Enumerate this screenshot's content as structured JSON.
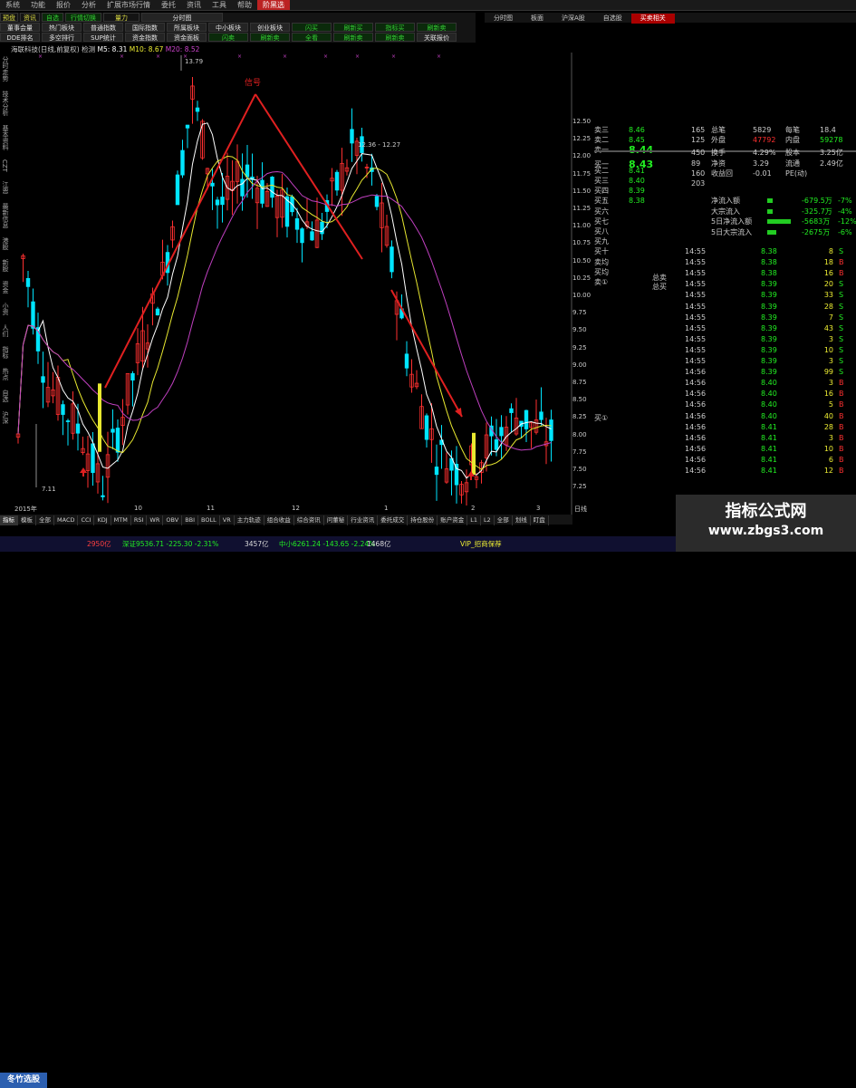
{
  "menu": [
    "系统",
    "功能",
    "报价",
    "分析",
    "扩展市场行情",
    "委托",
    "资讯",
    "工具",
    "帮助",
    "阶黑选"
  ],
  "menu_active_index": 9,
  "toolbar_row1": [
    "预盘",
    "资讯",
    "自选",
    "行情切换",
    "量力",
    "分时图"
  ],
  "toolbar_row2": [
    "董事会量",
    "热门板块",
    "普通指数",
    "国际指数",
    "所属板块",
    "中小板块",
    "创业板块",
    "闪买",
    "刷新买",
    "指标买",
    "刷新卖"
  ],
  "toolbar_row3": [
    "DDE排名",
    "多空排行",
    "SUP统计",
    "资金指数",
    "资金面板",
    "闪卖",
    "刷新卖",
    "全看",
    "刷新卖",
    "刷新卖",
    "关联报价"
  ],
  "right_toolbar": [
    "分时图",
    "板面",
    "沪深A股",
    "自选股",
    "买卖相关"
  ],
  "chart_title": {
    "name": "海联科技(日线,前复权) 检测",
    "m5": "M5: 8.31",
    "m10": "M10: 8.67",
    "m20": "M20: 8.52"
  },
  "left_strip": [
    "分时走势",
    "技术分析",
    "基本资料",
    "CZT",
    "江恩",
    "最新信息",
    "港股",
    "新股",
    "资金",
    "小资",
    "人们",
    "指标",
    "热点",
    "自选",
    "沪深"
  ],
  "annotations": {
    "peak": "13.79",
    "signal": "信号",
    "range": "12.36 - 12.27",
    "low": "7.11"
  },
  "y_axis": [
    "12.50",
    "12.25",
    "12.00",
    "11.75",
    "11.50",
    "11.25",
    "11.00",
    "10.75",
    "10.50",
    "10.25",
    "10.00",
    "9.75",
    "9.50",
    "9.25",
    "9.00",
    "8.75",
    "8.50",
    "8.25",
    "8.00",
    "7.75",
    "7.50",
    "7.25"
  ],
  "x_axis": [
    "2015年",
    "10",
    "11",
    "12",
    "1",
    "2",
    "3"
  ],
  "x_axis_right": "日线",
  "orderbook": [
    {
      "label": "卖三",
      "price": "8.46",
      "big": false
    },
    {
      "label": "卖二",
      "price": "8.45",
      "big": false
    },
    {
      "label": "卖一",
      "price": "8.44",
      "big": true
    },
    {
      "label": "买一",
      "price": "8.43",
      "big": true
    },
    {
      "label": "买二",
      "price": "8.41",
      "big": false
    },
    {
      "label": "买三",
      "price": "8.40",
      "big": false
    },
    {
      "label": "买四",
      "price": "8.39",
      "big": false
    },
    {
      "label": "买五",
      "price": "8.38",
      "big": false
    },
    {
      "label": "买六",
      "price": "",
      "big": false
    },
    {
      "label": "买七",
      "price": "",
      "big": false
    },
    {
      "label": "买八",
      "price": "",
      "big": false
    },
    {
      "label": "买九",
      "price": "",
      "big": false
    },
    {
      "label": "买十",
      "price": "",
      "big": false
    },
    {
      "label": "卖均",
      "price": "",
      "big": false
    },
    {
      "label": "买均",
      "price": "",
      "big": false
    },
    {
      "label": "卖①",
      "price": "",
      "big": false
    }
  ],
  "buy_marker": "买①",
  "mid_volumes": [
    "165",
    "125",
    "450",
    "89",
    "160",
    "203"
  ],
  "stats": [
    {
      "k": "总笔",
      "v": "5829",
      "k2": "每笔",
      "v2": "18.4"
    },
    {
      "k": "外盘",
      "v": "47792",
      "k2": "内盘",
      "v2": "59278"
    },
    {
      "k": "换手",
      "v": "4.29%",
      "k2": "股本",
      "v2": "3.25亿"
    },
    {
      "k": "净资",
      "v": "3.29",
      "k2": "流通",
      "v2": "2.49亿"
    },
    {
      "k": "收益回",
      "v": "-0.01",
      "k2": "PE(动)",
      "v2": ""
    }
  ],
  "flows": [
    {
      "k": "净流入额",
      "v": "-679.5万",
      "p": "-7%"
    },
    {
      "k": "大宗流入",
      "v": "-325.7万",
      "p": "-4%"
    },
    {
      "k": "5日净流入额",
      "v": "-5683万",
      "p": "-12%"
    },
    {
      "k": "5日大宗流入",
      "v": "-2675万",
      "p": "-6%"
    }
  ],
  "totals": {
    "sell": "总卖",
    "buy": "总买"
  },
  "trades": [
    {
      "t": "14:55",
      "p": "8.38",
      "v": "8",
      "s": "S"
    },
    {
      "t": "14:55",
      "p": "8.38",
      "v": "18",
      "s": "B"
    },
    {
      "t": "14:55",
      "p": "8.38",
      "v": "16",
      "s": "B"
    },
    {
      "t": "14:55",
      "p": "8.39",
      "v": "20",
      "s": "S"
    },
    {
      "t": "14:55",
      "p": "8.39",
      "v": "33",
      "s": "S"
    },
    {
      "t": "14:55",
      "p": "8.39",
      "v": "28",
      "s": "S"
    },
    {
      "t": "14:55",
      "p": "8.39",
      "v": "7",
      "s": "S"
    },
    {
      "t": "14:55",
      "p": "8.39",
      "v": "43",
      "s": "S"
    },
    {
      "t": "14:55",
      "p": "8.39",
      "v": "3",
      "s": "S"
    },
    {
      "t": "14:55",
      "p": "8.39",
      "v": "10",
      "s": "S"
    },
    {
      "t": "14:55",
      "p": "8.39",
      "v": "3",
      "s": "S"
    },
    {
      "t": "14:56",
      "p": "8.39",
      "v": "99",
      "s": "S"
    },
    {
      "t": "14:56",
      "p": "8.40",
      "v": "3",
      "s": "B"
    },
    {
      "t": "14:56",
      "p": "8.40",
      "v": "16",
      "s": "B"
    },
    {
      "t": "14:56",
      "p": "8.40",
      "v": "5",
      "s": "B"
    },
    {
      "t": "14:56",
      "p": "8.40",
      "v": "40",
      "s": "B"
    },
    {
      "t": "14:56",
      "p": "8.41",
      "v": "28",
      "s": "B"
    },
    {
      "t": "14:56",
      "p": "8.41",
      "v": "3",
      "s": "B"
    },
    {
      "t": "14:56",
      "p": "8.41",
      "v": "10",
      "s": "B"
    },
    {
      "t": "14:56",
      "p": "8.41",
      "v": "6",
      "s": "B"
    },
    {
      "t": "14:56",
      "p": "8.41",
      "v": "12",
      "s": "B"
    }
  ],
  "bottom_tabs": [
    "指标",
    "模板",
    "全部",
    "MACD",
    "CCI",
    "KDJ",
    "MTM",
    "RSI",
    "WR",
    "OBV",
    "BBI",
    "BOLL",
    "VR",
    "主力轨迹",
    "组合收益",
    "综合资讯",
    "问董秘",
    "行业资讯",
    "委托成交",
    "持仓股份",
    "账户资金",
    "L1",
    "L2",
    "全部",
    "划线",
    "盯盘"
  ],
  "status": {
    "start": "冬竹选股",
    "s1": "2950亿",
    "s2": "深证9536.71 -225.30 -2.31%",
    "s3": "3457亿",
    "s4": "中小6261.24 -143.65 -2.24%",
    "s5": "1468亿",
    "s6": "VIP_招商保荐"
  },
  "watermark": {
    "line1": "指标公式网",
    "line2": "www.zbgs3.com"
  },
  "colors": {
    "up": "#ff3030",
    "down": "#00e5ff",
    "ma5": "#ffffff",
    "ma10": "#e8e830",
    "ma20": "#c040c0",
    "bid_green": "#22ee22",
    "sell_green": "#22ee22",
    "buy_red": "#ff3030"
  }
}
